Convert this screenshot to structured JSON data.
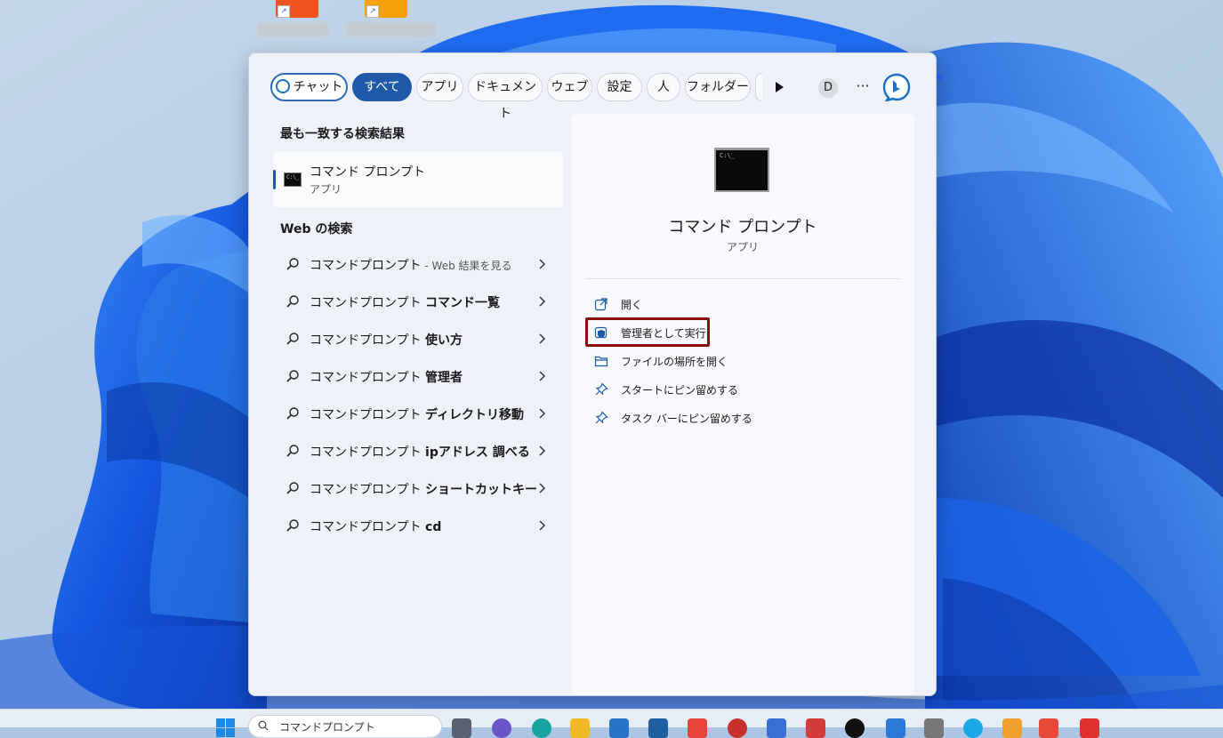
{
  "tabs": [
    {
      "label": "チャット"
    },
    {
      "label": "すべて"
    },
    {
      "label": "アプリ"
    },
    {
      "label": "ドキュメント"
    },
    {
      "label": "ウェブ"
    },
    {
      "label": "設定"
    },
    {
      "label": "人"
    },
    {
      "label": "フォルダー"
    }
  ],
  "active_tab": "すべて",
  "account_initial": "D",
  "more_label": "···",
  "best_match": {
    "section_title": "最も一致する検索結果",
    "name": "コマンド プロンプト",
    "type": "アプリ"
  },
  "web_search": {
    "section_title": "Web の検索",
    "items": [
      {
        "base": "コマンドプロンプト",
        "bold": "",
        "suffix": " - Web 結果を見る"
      },
      {
        "base": "コマンドプロンプト ",
        "bold": "コマンド一覧",
        "suffix": ""
      },
      {
        "base": "コマンドプロンプト ",
        "bold": "使い方",
        "suffix": ""
      },
      {
        "base": "コマンドプロンプト ",
        "bold": "管理者",
        "suffix": ""
      },
      {
        "base": "コマンドプロンプト ",
        "bold": "ディレクトリ移動",
        "suffix": ""
      },
      {
        "base": "コマンドプロンプト ",
        "bold": "ipアドレス 調べる",
        "suffix": ""
      },
      {
        "base": "コマンドプロンプト ",
        "bold": "ショートカットキー",
        "suffix": ""
      },
      {
        "base": "コマンドプロンプト ",
        "bold": "cd",
        "suffix": ""
      }
    ]
  },
  "preview": {
    "title": "コマンド プロンプト",
    "subtitle": "アプリ",
    "actions": [
      {
        "label": "開く",
        "icon": "open-external-icon"
      },
      {
        "label": "管理者として実行",
        "icon": "shield-admin-icon",
        "highlighted": true
      },
      {
        "label": "ファイルの場所を開く",
        "icon": "folder-icon"
      },
      {
        "label": "スタートにピン留めする",
        "icon": "pin-icon"
      },
      {
        "label": "タスク バーにピン留めする",
        "icon": "pin-icon"
      }
    ]
  },
  "taskbar": {
    "search_query": "コマンドプロンプト"
  },
  "colors": {
    "accent": "#1e5aa8",
    "highlight_border": "#8b0f0f",
    "wallpaper_blue": "#1a5fe0"
  }
}
